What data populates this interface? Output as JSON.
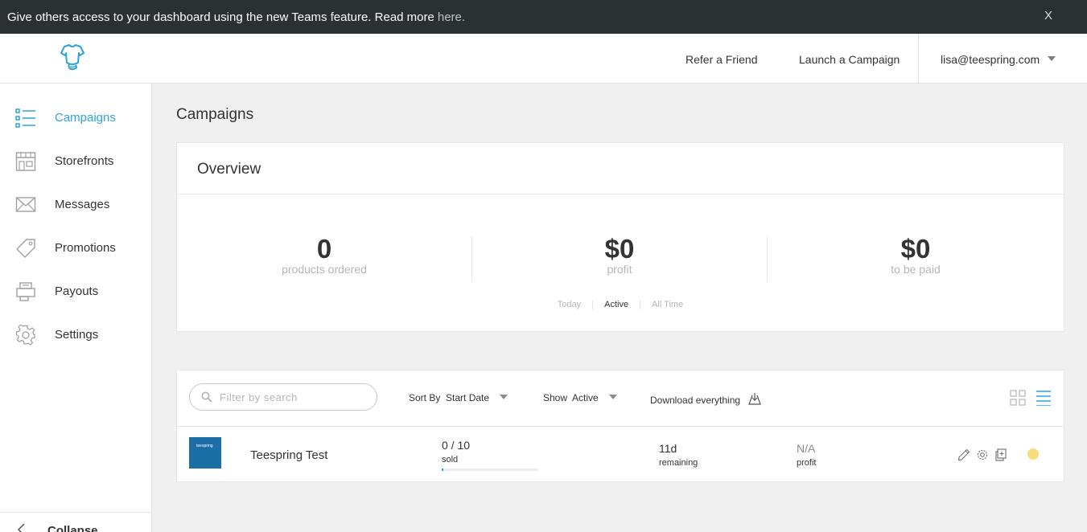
{
  "banner": {
    "text": "Give others access to your dashboard using the new Teams feature. Read more",
    "link": "here.",
    "close": "X"
  },
  "header": {
    "logo_icon": "teespring-shirt-logo",
    "refer": "Refer a Friend",
    "launch": "Launch a Campaign",
    "user_email": "lisa@teespring.com"
  },
  "sidebar": {
    "items": [
      {
        "label": "Campaigns",
        "icon": "list-icon",
        "active": true
      },
      {
        "label": "Storefronts",
        "icon": "storefront-icon",
        "active": false
      },
      {
        "label": "Messages",
        "icon": "envelope-icon",
        "active": false
      },
      {
        "label": "Promotions",
        "icon": "tag-icon",
        "active": false
      },
      {
        "label": "Payouts",
        "icon": "payout-icon",
        "active": false
      },
      {
        "label": "Settings",
        "icon": "gear-icon",
        "active": false
      }
    ],
    "collapse": "Collapse"
  },
  "main": {
    "title": "Campaigns",
    "overview": {
      "title": "Overview",
      "stats": [
        {
          "value": "0",
          "label": "products ordered"
        },
        {
          "value": "$0",
          "label": "profit"
        },
        {
          "value": "$0",
          "label": "to be paid"
        }
      ],
      "periods": [
        {
          "label": "Today",
          "selected": false
        },
        {
          "label": "Active",
          "selected": true
        },
        {
          "label": "All Time",
          "selected": false
        }
      ]
    },
    "toolbar": {
      "search_placeholder": "Filter by search",
      "sort_label": "Sort By",
      "sort_value": "Start Date",
      "show_label": "Show",
      "show_value": "Active",
      "download": "Download everything"
    },
    "campaigns": [
      {
        "thumb_text": "teespring",
        "name": "Teespring Test",
        "sold": "0 / 10",
        "sold_label": "sold",
        "sold_fraction": 0.0,
        "remaining": "11d",
        "remaining_label": "remaining",
        "profit": "N/A",
        "profit_label": "profit",
        "status_color": "#f7dd7a"
      }
    ]
  },
  "colors": {
    "accent": "#2ea3d8",
    "banner_bg": "#2b3133"
  }
}
